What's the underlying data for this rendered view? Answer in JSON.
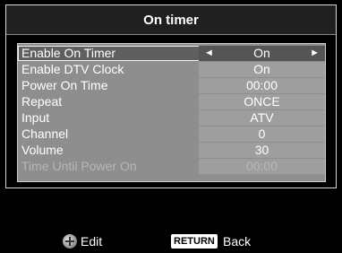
{
  "title": "On timer",
  "rows": [
    {
      "label": "Enable On Timer",
      "value": "On"
    },
    {
      "label": "Enable DTV Clock",
      "value": "On"
    },
    {
      "label": "Power On Time",
      "value": "00:00"
    },
    {
      "label": "Repeat",
      "value": "ONCE"
    },
    {
      "label": "Input",
      "value": "ATV"
    },
    {
      "label": "Channel",
      "value": "0"
    },
    {
      "label": "Volume",
      "value": "30"
    },
    {
      "label": "Time Until Power On",
      "value": "00:00"
    }
  ],
  "arrows": {
    "left": "◄",
    "right": "►"
  },
  "footer": {
    "edit_label": "Edit",
    "return_key": "RETURN",
    "back_label": "Back"
  }
}
